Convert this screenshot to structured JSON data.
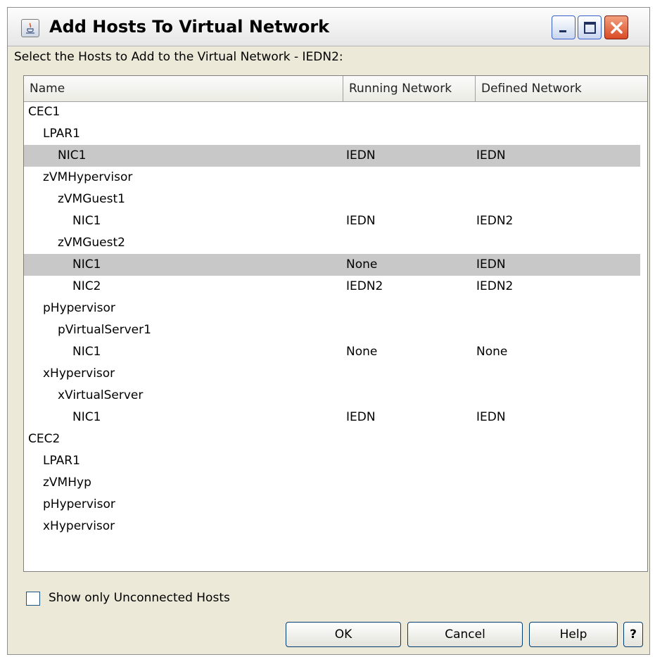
{
  "window": {
    "title": "Add Hosts To Virtual Network",
    "controls": {
      "minimize_icon": "minimize-icon",
      "maximize_icon": "maximize-icon",
      "close_icon": "close-icon"
    }
  },
  "prompt": "Select the Hosts to Add to the Virtual Network - IEDN2:",
  "table": {
    "columns": [
      "Name",
      "Running Network",
      "Defined Network"
    ],
    "rows": [
      {
        "name": "CEC1",
        "level": 0,
        "running": "",
        "defined": "",
        "selected": false
      },
      {
        "name": "LPAR1",
        "level": 1,
        "running": "",
        "defined": "",
        "selected": false
      },
      {
        "name": "NIC1",
        "level": 2,
        "running": "IEDN",
        "defined": "IEDN",
        "selected": true
      },
      {
        "name": "zVMHypervisor",
        "level": 1,
        "running": "",
        "defined": "",
        "selected": false
      },
      {
        "name": "zVMGuest1",
        "level": 2,
        "running": "",
        "defined": "",
        "selected": false
      },
      {
        "name": "NIC1",
        "level": 3,
        "running": "IEDN",
        "defined": "IEDN2",
        "selected": false
      },
      {
        "name": "zVMGuest2",
        "level": 2,
        "running": "",
        "defined": "",
        "selected": false
      },
      {
        "name": "NIC1",
        "level": 3,
        "running": "None",
        "defined": "IEDN",
        "selected": true
      },
      {
        "name": "NIC2",
        "level": 3,
        "running": "IEDN2",
        "defined": "IEDN2",
        "selected": false
      },
      {
        "name": "pHypervisor",
        "level": 1,
        "running": "",
        "defined": "",
        "selected": false
      },
      {
        "name": "pVirtualServer1",
        "level": 2,
        "running": "",
        "defined": "",
        "selected": false
      },
      {
        "name": "NIC1",
        "level": 3,
        "running": "None",
        "defined": "None",
        "selected": false
      },
      {
        "name": "xHypervisor",
        "level": 1,
        "running": "",
        "defined": "",
        "selected": false
      },
      {
        "name": "xVirtualServer",
        "level": 2,
        "running": "",
        "defined": "",
        "selected": false
      },
      {
        "name": "NIC1",
        "level": 3,
        "running": "IEDN",
        "defined": "IEDN",
        "selected": false
      },
      {
        "name": "CEC2",
        "level": 0,
        "running": "",
        "defined": "",
        "selected": false
      },
      {
        "name": "LPAR1",
        "level": 1,
        "running": "",
        "defined": "",
        "selected": false
      },
      {
        "name": "zVMHyp",
        "level": 1,
        "running": "",
        "defined": "",
        "selected": false
      },
      {
        "name": "pHypervisor",
        "level": 1,
        "running": "",
        "defined": "",
        "selected": false
      },
      {
        "name": "xHypervisor",
        "level": 1,
        "running": "",
        "defined": "",
        "selected": false
      }
    ],
    "selected_row_color": "#c8c8c8"
  },
  "filter": {
    "label": "Show only Unconnected Hosts",
    "checked": false
  },
  "buttons": {
    "ok": "OK",
    "cancel": "Cancel",
    "help": "Help",
    "context_help": "?"
  }
}
